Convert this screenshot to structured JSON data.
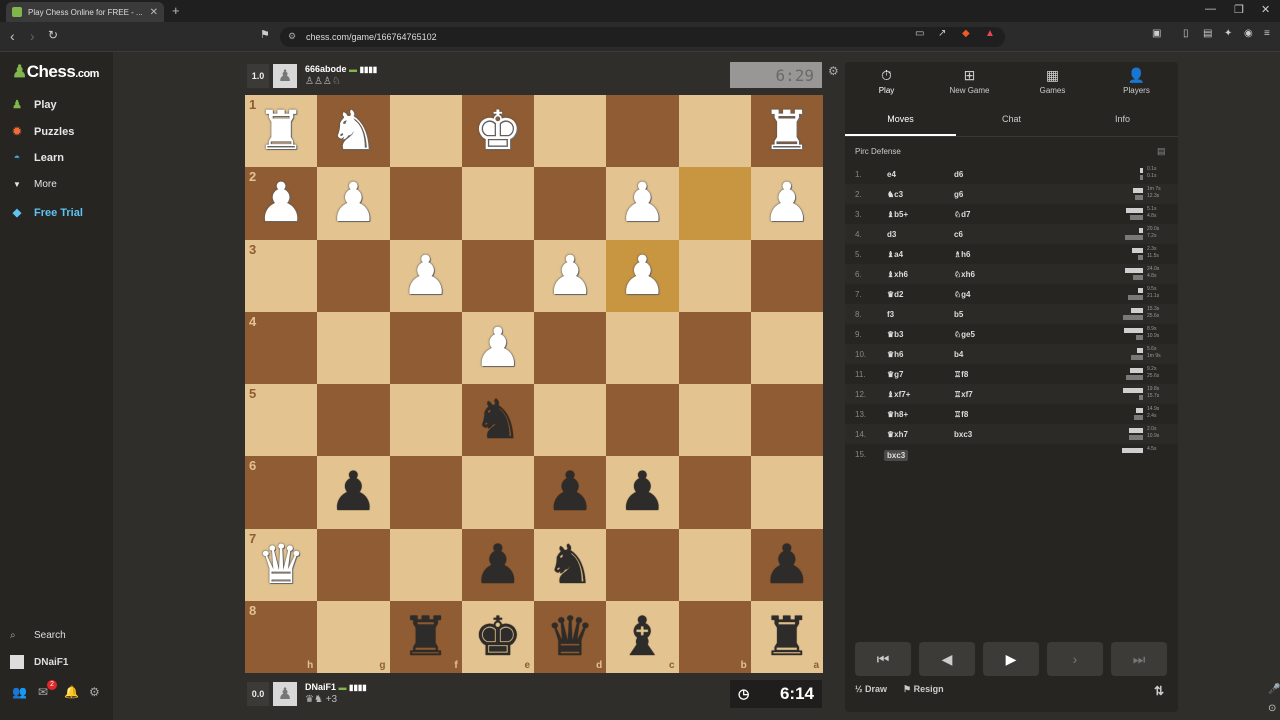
{
  "browser": {
    "tab_title": "Play Chess Online for FREE - ...",
    "url": "chess.com/game/166764765102"
  },
  "sidebar": {
    "logo": "Chess",
    "logo_suffix": ".com",
    "items": [
      {
        "label": "Play",
        "icon": "play-icon"
      },
      {
        "label": "Puzzles",
        "icon": "puzzle-icon"
      },
      {
        "label": "Learn",
        "icon": "learn-icon"
      },
      {
        "label": "More",
        "icon": "chevron-down-icon"
      },
      {
        "label": "Free Trial",
        "icon": "diamond-icon"
      }
    ],
    "search_label": "Search",
    "username": "DNaiF1",
    "notification_count": "2"
  },
  "top_player": {
    "eval": "1.0",
    "name": "666abode",
    "captured": "♙♙♙♘",
    "clock": "6:29"
  },
  "bottom_player": {
    "eval": "0.0",
    "name": "DNaiF1",
    "captured": "♛♞ +3",
    "clock": "6:14"
  },
  "board": {
    "colors": {
      "light": "#e3c38f",
      "dark": "#8f5c33",
      "highlight": "#c89540"
    },
    "ranks_label": [
      "1",
      "2",
      "3",
      "4",
      "5",
      "6",
      "7",
      "8"
    ],
    "files_label": [
      "h",
      "g",
      "f",
      "e",
      "d",
      "c",
      "b",
      "a"
    ],
    "rows": [
      [
        "wR",
        "wN",
        "",
        "wK",
        "",
        "",
        "",
        "wR"
      ],
      [
        "wP",
        "wP",
        "",
        "",
        "",
        "wP",
        "",
        "wP"
      ],
      [
        "",
        "",
        "wP",
        "",
        "wP",
        "wP",
        "",
        ""
      ],
      [
        "",
        "",
        "",
        "wP",
        "",
        "",
        "",
        ""
      ],
      [
        "",
        "",
        "",
        "bN",
        "",
        "",
        "",
        ""
      ],
      [
        "",
        "bP",
        "",
        "",
        "bP",
        "bP",
        "",
        ""
      ],
      [
        "wQ",
        "",
        "",
        "bP",
        "bN",
        "",
        "",
        "bP"
      ],
      [
        "",
        "",
        "bR",
        "bK",
        "bQ",
        "bB",
        "",
        "bR"
      ]
    ],
    "highlighted": [
      [
        1,
        6
      ],
      [
        2,
        5
      ]
    ]
  },
  "panel": {
    "top_tabs": [
      {
        "label": "Play",
        "icon": "stopwatch-icon"
      },
      {
        "label": "New Game",
        "icon": "plus-icon"
      },
      {
        "label": "Games",
        "icon": "board-icon"
      },
      {
        "label": "Players",
        "icon": "players-icon"
      }
    ],
    "tabs": [
      "Moves",
      "Chat",
      "Info"
    ],
    "opening": "Pirc Defense",
    "moves": [
      {
        "n": "1.",
        "w": "e4",
        "b": "d6",
        "wt": "0.1s",
        "bt": "0.1s"
      },
      {
        "n": "2.",
        "w": "♞c3",
        "b": "g6",
        "wt": "1m 7s",
        "bt": "12.3s"
      },
      {
        "n": "3.",
        "w": "♝b5+",
        "b": "♘d7",
        "wt": "5.1s",
        "bt": "4.8s"
      },
      {
        "n": "4.",
        "w": "d3",
        "b": "c6",
        "wt": "20.0s",
        "bt": "7.2s"
      },
      {
        "n": "5.",
        "w": "♝a4",
        "b": "♗h6",
        "wt": "2.3s",
        "bt": "11.5s"
      },
      {
        "n": "6.",
        "w": "♝xh6",
        "b": "♘xh6",
        "wt": "24.0s",
        "bt": "4.8s"
      },
      {
        "n": "7.",
        "w": "♛d2",
        "b": "♘g4",
        "wt": "9.5s",
        "bt": "21.1s"
      },
      {
        "n": "8.",
        "w": "f3",
        "b": "b5",
        "wt": "15.3s",
        "bt": "25.6s"
      },
      {
        "n": "9.",
        "w": "♛b3",
        "b": "♘ge5",
        "wt": "8.9s",
        "bt": "10.9s"
      },
      {
        "n": "10.",
        "w": "♛h6",
        "b": "b4",
        "wt": "5.6s",
        "bt": "1m 9s"
      },
      {
        "n": "11.",
        "w": "♛g7",
        "b": "♖f8",
        "wt": "9.2s",
        "bt": "25.6s"
      },
      {
        "n": "12.",
        "w": "♝xf7+",
        "b": "♖xf7",
        "wt": "19.8s",
        "bt": "15.7s"
      },
      {
        "n": "13.",
        "w": "♛h8+",
        "b": "♖f8",
        "wt": "14.9s",
        "bt": "2.4s"
      },
      {
        "n": "14.",
        "w": "♛xh7",
        "b": "bxc3",
        "wt": "2.0s",
        "bt": "10.9s"
      },
      {
        "n": "15.",
        "w": "bxc3",
        "b": "",
        "wt": "4.5s",
        "bt": ""
      }
    ],
    "draw_label": "Draw",
    "draw_prefix": "½",
    "resign_label": "Resign"
  }
}
